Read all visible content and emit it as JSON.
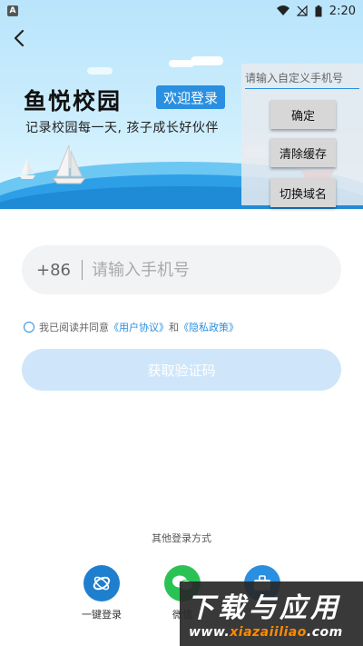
{
  "status_bar": {
    "time": "2:20",
    "app_badge": "A"
  },
  "header": {
    "brand_title": "鱼悦校园",
    "welcome_badge": "欢迎登录",
    "slogan": "记录校园每一天, 孩子成长好伙伴"
  },
  "debug_panel": {
    "input_placeholder": "请输入自定义手机号",
    "confirm_label": "确定",
    "clear_cache_label": "清除缓存",
    "switch_domain_label": "切换域名"
  },
  "login_form": {
    "country_code": "+86",
    "phone_placeholder": "请输入手机号",
    "agree_prefix": "我已阅读并同意",
    "user_agreement": "《用户协议》",
    "agree_and": "和",
    "privacy_policy": "《隐私政策》",
    "get_code_label": "获取验证码"
  },
  "other_login": {
    "title": "其他登录方式",
    "options": [
      {
        "label": "一键登录",
        "icon": "china-mobile-icon",
        "color": "#1f7fcf"
      },
      {
        "label": "微信",
        "icon": "wechat-icon",
        "color": "#2bc255"
      },
      {
        "label": "",
        "icon": "briefcase-icon",
        "color": "#2a8fe0"
      }
    ]
  },
  "watermark": {
    "title": "下载与应用",
    "url_prefix": "www.",
    "url_main": "xiazaiiliao",
    "url_suffix": ".com"
  },
  "colors": {
    "accent": "#2a8fe0",
    "button_disabled": "#cfe6fa"
  }
}
